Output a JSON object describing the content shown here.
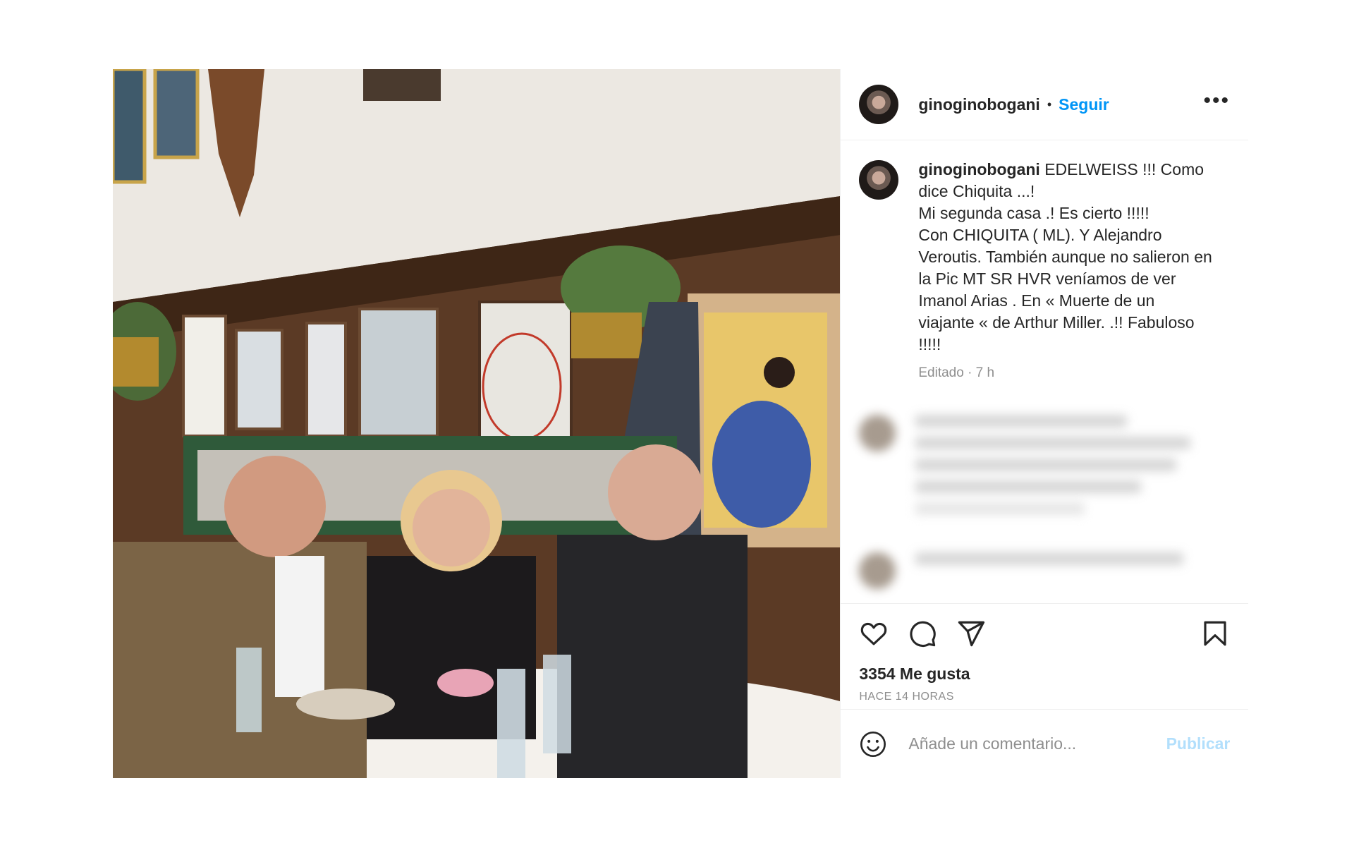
{
  "post": {
    "username": "ginoginobogani",
    "follow_label": "Seguir",
    "more_label": "•••",
    "caption": {
      "username": "ginoginobogani",
      "text": "EDELWEISS !!! Como dice Chiquita ...!\nMi segunda casa .! Es cierto !!!!!\nCon CHIQUITA ( ML). Y Alejandro Veroutis. También aunque no salieron en la Pic MT SR HVR veníamos de ver Imanol Arias . En « Muerte de un viajante «  de Arthur Miller. .!! Fabuloso !!!!!",
      "meta": "Editado · 7 h"
    },
    "likes": "3354 Me gusta",
    "time_ago": "HACE 14 HORAS",
    "comment_placeholder": "Añade un comentario...",
    "publish_label": "Publicar"
  },
  "icons": {
    "like": "heart-icon",
    "comment": "comment-icon",
    "share": "send-icon",
    "save": "bookmark-icon",
    "emoji": "smile-icon"
  },
  "colors": {
    "link": "#0095f6",
    "publish_disabled": "#b2dffc",
    "secondary_text": "#8e8e8e"
  }
}
